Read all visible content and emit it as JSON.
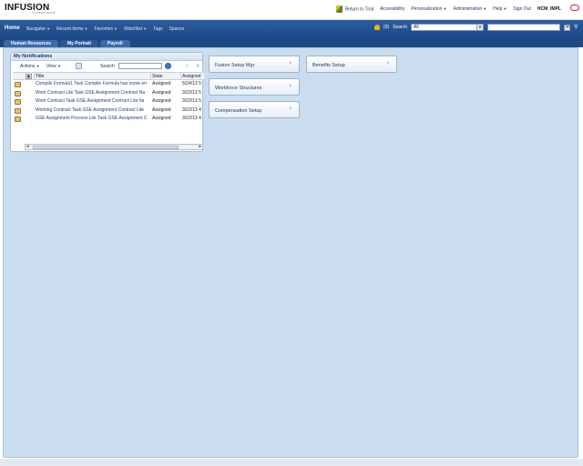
{
  "branding": {
    "logo_text": "INFUSION",
    "logo_tagline": "SYSTEMS GROUP"
  },
  "toplinks": {
    "return_to_trial": "Return to Trial",
    "accessibility": "Accessibility",
    "personalization": "Personalization",
    "administration": "Administration",
    "help": "Help",
    "sign_out": "Sign Out",
    "user": "HCM_IMPL"
  },
  "nav": {
    "home": "Home",
    "navigator": "Navigator",
    "recent_items": "Recent Items",
    "favorites": "Favorites",
    "watchlist": "Watchlist",
    "tags": "Tags",
    "spaces": "Spaces",
    "notification_count": "(0)",
    "search_label": "Search",
    "search_scope": "All"
  },
  "tabs": [
    {
      "label": "Human Resources"
    },
    {
      "label": "My Portrait"
    },
    {
      "label": "Payroll"
    }
  ],
  "notifications": {
    "title": "My Notifications",
    "actions": "Actions",
    "view": "View",
    "search_label": "Search",
    "columns": {
      "title": "Title",
      "state": "State",
      "assigned": "Assigned"
    },
    "rows": [
      {
        "title": "Compile Formula1 Task Compile Formula has some err",
        "state": "Assigned",
        "assigned": "5/24/13 5"
      },
      {
        "title": "Work Contract Lite Task GSE Assignment Contract Na",
        "state": "Assigned",
        "assigned": "3/22/13 5"
      },
      {
        "title": "Work Contract Task GSE Assignment Contract Lite ha",
        "state": "Assigned",
        "assigned": "3/22/13 5"
      },
      {
        "title": "Working Contract Task GSE Assignment Contract Lite",
        "state": "Assigned",
        "assigned": "3/22/13 4"
      },
      {
        "title": "GSE Assignment Process Lite Task GSE Assignment C",
        "state": "Assigned",
        "assigned": "3/22/13 4"
      }
    ]
  },
  "tiles": {
    "fusion_setup": "Fusion Setup Mgr",
    "workforce_structures": "Workforce Structures",
    "compensation_setup": "Compensation Setup",
    "benefits_setup": "Benefits Setup"
  },
  "colors": {
    "nav_blue": "#1c4884",
    "canvas_blue": "#c9ddee",
    "link_blue": "#1b3d86"
  }
}
